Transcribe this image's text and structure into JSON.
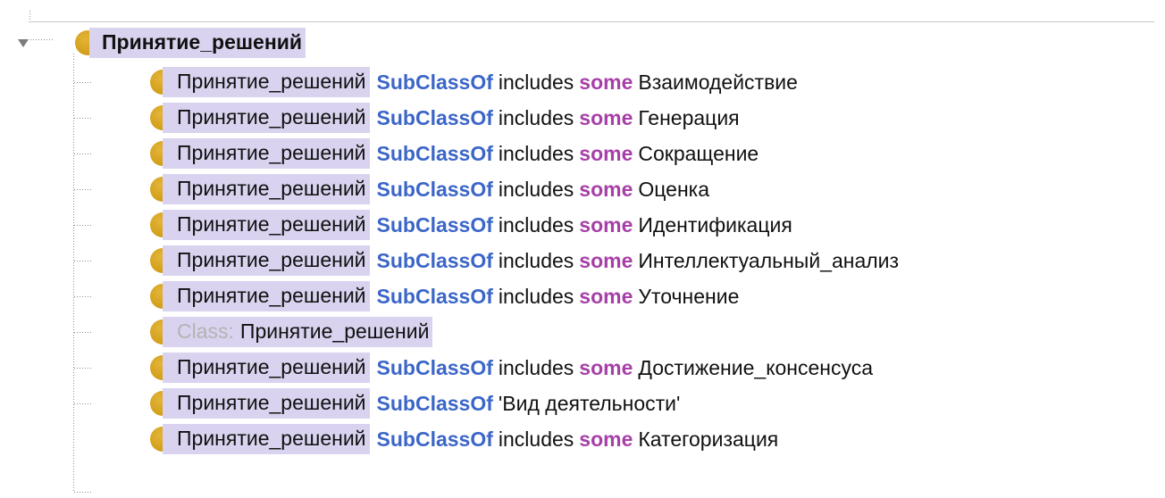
{
  "root": {
    "title": "Принятие_решений",
    "expander_icon": "triangle-down-icon",
    "node_icon": "class-dot-icon"
  },
  "rows": [
    {
      "subject": "Принятие_решений",
      "keyword": "SubClassOf",
      "property": "includes",
      "quantifier": "some",
      "object": "Взаимодействие"
    },
    {
      "subject": "Принятие_решений",
      "keyword": "SubClassOf",
      "property": "includes",
      "quantifier": "some",
      "object": "Генерация"
    },
    {
      "subject": "Принятие_решений",
      "keyword": "SubClassOf",
      "property": "includes",
      "quantifier": "some",
      "object": "Сокращение"
    },
    {
      "subject": "Принятие_решений",
      "keyword": "SubClassOf",
      "property": "includes",
      "quantifier": "some",
      "object": "Оценка"
    },
    {
      "subject": "Принятие_решений",
      "keyword": "SubClassOf",
      "property": "includes",
      "quantifier": "some",
      "object": "Идентификация"
    },
    {
      "subject": "Принятие_решений",
      "keyword": "SubClassOf",
      "property": "includes",
      "quantifier": "some",
      "object": "Интеллектуальный_анализ"
    },
    {
      "subject": "Принятие_решений",
      "keyword": "SubClassOf",
      "property": "includes",
      "quantifier": "some",
      "object": "Уточнение"
    },
    {
      "class_label": "Class:",
      "subject": "Принятие_решений"
    },
    {
      "subject": "Принятие_решений",
      "keyword": "SubClassOf",
      "property": "includes",
      "quantifier": "some",
      "object": "Достижение_консенсуса"
    },
    {
      "subject": "Принятие_решений",
      "keyword": "SubClassOf",
      "object": "'Вид деятельности'"
    },
    {
      "subject": "Принятие_решений",
      "keyword": "SubClassOf",
      "property": "includes",
      "quantifier": "some",
      "object": "Категоризация"
    }
  ],
  "colors": {
    "selection_bg": "#d9d3ef",
    "keyword_blue": "#3b66c8",
    "quantifier_purple": "#a73fa8",
    "class_dot": "#d4a11b",
    "class_label_gray": "#b3b3b3"
  }
}
